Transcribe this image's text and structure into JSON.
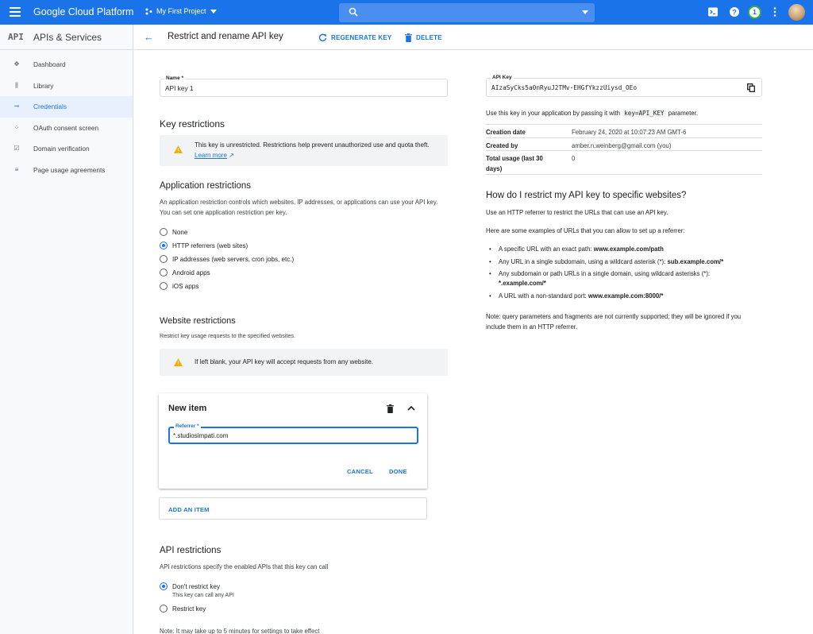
{
  "topbar": {
    "brand": "Google Cloud Platform",
    "project": "My First Project",
    "notifications_count": "1",
    "search_placeholder": ""
  },
  "sidebar": {
    "badge": "API",
    "title": "APIs & Services",
    "items": [
      {
        "label": "Dashboard",
        "icon": "dashboard-icon"
      },
      {
        "label": "Library",
        "icon": "library-icon"
      },
      {
        "label": "Credentials",
        "icon": "key-icon",
        "active": true
      },
      {
        "label": "OAuth consent screen",
        "icon": "oauth-icon"
      },
      {
        "label": "Domain verification",
        "icon": "domain-verification-icon"
      },
      {
        "label": "Page usage agreements",
        "icon": "page-usage-icon"
      }
    ]
  },
  "header": {
    "title": "Restrict and rename API key",
    "regenerate": "REGENERATE KEY",
    "delete": "DELETE"
  },
  "form": {
    "name_label": "Name *",
    "name_value": "API key 1",
    "key_restrictions_title": "Key restrictions",
    "unrestricted_warning": "This key is unrestricted. Restrictions help prevent unauthorized use and quota theft.",
    "learn_more": "Learn more",
    "app_restrictions_title": "Application restrictions",
    "app_restrictions_desc": "An application restriction controls which websites, IP addresses, or applications can use your API key. You can set one application restriction per key.",
    "app_options": [
      {
        "label": "None",
        "selected": false
      },
      {
        "label": "HTTP referrers (web sites)",
        "selected": true
      },
      {
        "label": "IP addresses (web servers, cron jobs, etc.)",
        "selected": false
      },
      {
        "label": "Android apps",
        "selected": false
      },
      {
        "label": "iOS apps",
        "selected": false
      }
    ],
    "website_restrictions_title": "Website restrictions",
    "website_restrictions_desc": "Restrict key usage requests to the specified websites.",
    "blank_warning": "If left blank, your API key will accept requests from any website.",
    "new_item": {
      "title": "New item",
      "referrer_label": "Referrer *",
      "referrer_value": "*.studiosimpati.com",
      "cancel": "CANCEL",
      "done": "DONE"
    },
    "add_item": "ADD AN ITEM",
    "api_restrictions_title": "API restrictions",
    "api_restrictions_desc": "API restrictions specify the enabled APIs that this key can call",
    "api_options": [
      {
        "label": "Don't restrict key",
        "sub": "This key can call any API",
        "selected": true
      },
      {
        "label": "Restrict key",
        "selected": false
      }
    ],
    "note": "Note: It may take up to 5 minutes for settings to take effect"
  },
  "key_panel": {
    "label": "API Key",
    "value": "AIzaSyCks5a0nRyuJ2TMv-EHGfYkzzUiysd_OEo",
    "usage_prefix": "Use this key in your application by passing it with",
    "usage_code": "key=API_KEY",
    "usage_suffix": "parameter.",
    "details": [
      {
        "k": "Creation date",
        "v": "February 24, 2020 at 10:07:23 AM GMT-6"
      },
      {
        "k": "Created by",
        "v": "amber.n.weinberg@gmail.com (you)"
      },
      {
        "k": "Total usage (last 30 days)",
        "v": "0"
      }
    ]
  },
  "help": {
    "title": "How do I restrict my API key to specific websites?",
    "intro": "Use an HTTP referrer to restrict the URLs that can use an API key.",
    "examples_intro": "Here are some examples of URLs that you can allow to set up a referrer:",
    "examples": [
      {
        "text": "A specific URL with an exact path: ",
        "bold": "www.example.com/path"
      },
      {
        "text": "Any URL in a single subdomain, using a wildcard asterisk (*): ",
        "bold": "sub.example.com/*"
      },
      {
        "text": "Any subdomain or path URLs in a single domain, using wildcard asterisks (*): ",
        "bold": "*.example.com/*"
      },
      {
        "text": "A URL with a non-standard port: ",
        "bold": "www.example.com:8000/*"
      }
    ],
    "note": "Note: query parameters and fragments are not currently supported; they will be ignored if you include them in an HTTP referrer."
  },
  "colors": {
    "accent": "#1a73e8",
    "topbar": "#1a73e8",
    "warning": "#f9ab00"
  }
}
